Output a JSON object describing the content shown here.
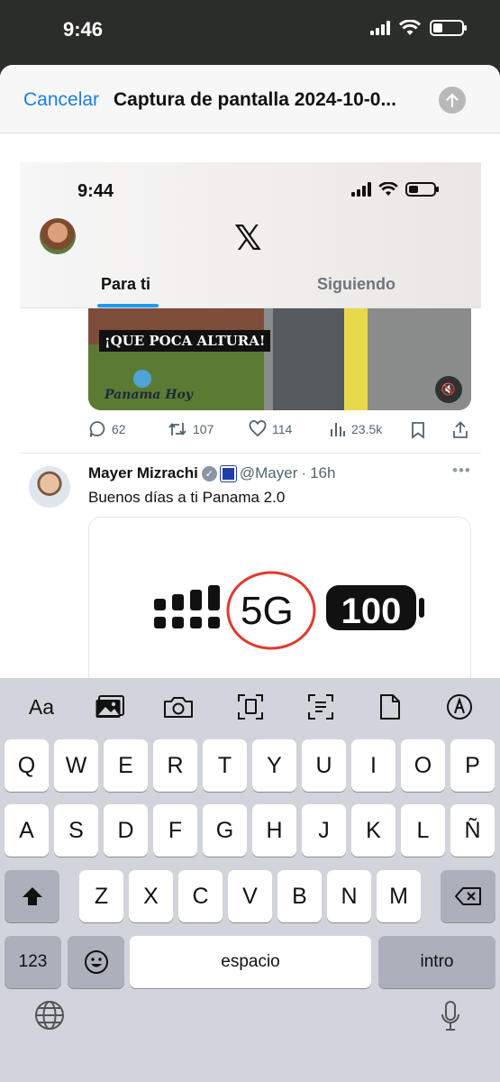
{
  "status_bar": {
    "time": "9:46"
  },
  "share_sheet": {
    "cancel_label": "Cancelar",
    "title": "Captura de pantalla 2024-10-0..."
  },
  "embedded": {
    "status_time": "9:44",
    "tabs": {
      "for_you": "Para ti",
      "following": "Siguiendo"
    },
    "video": {
      "banner": "¡QUE POCA ALTURA!",
      "watermark": "Panama Hoy"
    },
    "actions": {
      "replies": "62",
      "reposts": "107",
      "likes": "114",
      "views": "23.5k"
    },
    "tweet": {
      "author": "Mayer Mizrachi",
      "handle": "@Mayer",
      "time": "16h",
      "text": "Buenos días a ti Panama 2.0",
      "image_network": "5G",
      "image_battery": "100"
    }
  },
  "keyboard": {
    "toolbar": {
      "format": "Aa"
    },
    "rows": [
      [
        "Q",
        "W",
        "E",
        "R",
        "T",
        "Y",
        "U",
        "I",
        "O",
        "P"
      ],
      [
        "A",
        "S",
        "D",
        "F",
        "G",
        "H",
        "J",
        "K",
        "L",
        "Ñ"
      ],
      [
        "Z",
        "X",
        "C",
        "V",
        "B",
        "N",
        "M"
      ]
    ],
    "numbers_label": "123",
    "space_label": "espacio",
    "return_label": "intro"
  },
  "colors": {
    "accent": "#1a7ee8",
    "x_blue": "#1d9bf0",
    "keyboard_bg": "#d1d4db",
    "circle_red": "#e03a2e"
  }
}
